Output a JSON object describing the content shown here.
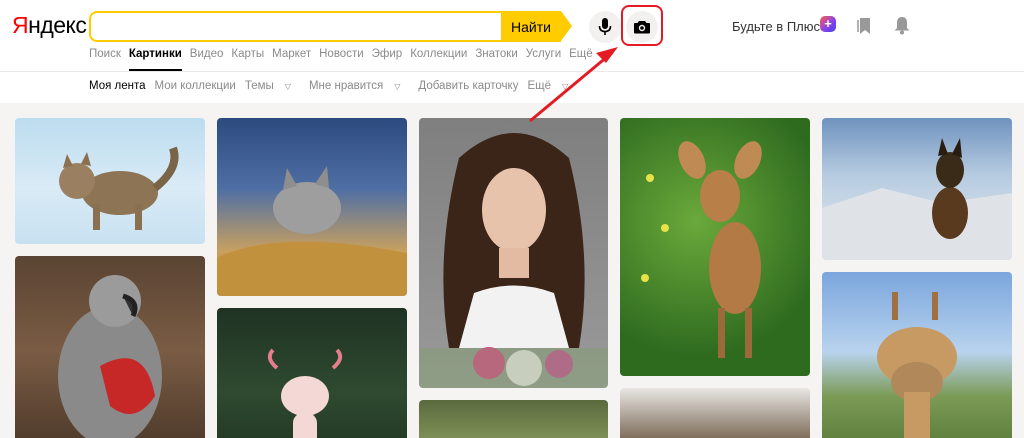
{
  "brand": {
    "first_letter": "Я",
    "rest": "ндекс"
  },
  "search": {
    "value": "",
    "placeholder": "",
    "button_label": "Найти"
  },
  "header": {
    "plus_text": "Будьте в Плюсе",
    "plus_badge": "+"
  },
  "services": [
    "Поиск",
    "Картинки",
    "Видео",
    "Карты",
    "Маркет",
    "Новости",
    "Эфир",
    "Коллекции",
    "Знатоки",
    "Услуги",
    "Ещё"
  ],
  "active_service": "Картинки",
  "subnav": {
    "feed": "Моя лента",
    "collections": "Мои коллекции",
    "themes": "Темы",
    "likes": "Мне нравится",
    "add_card": "Добавить карточку",
    "more": "Ещё"
  },
  "colors": {
    "accent": "#ffcc00",
    "highlight": "#e41b24",
    "logo_red": "#ff0000"
  },
  "tiles": [
    "cat",
    "kitten-in-grass",
    "woman-portrait",
    "fawn",
    "dog-in-snow",
    "parrot",
    "axolotl",
    "giraffe",
    "bird",
    "nest"
  ]
}
